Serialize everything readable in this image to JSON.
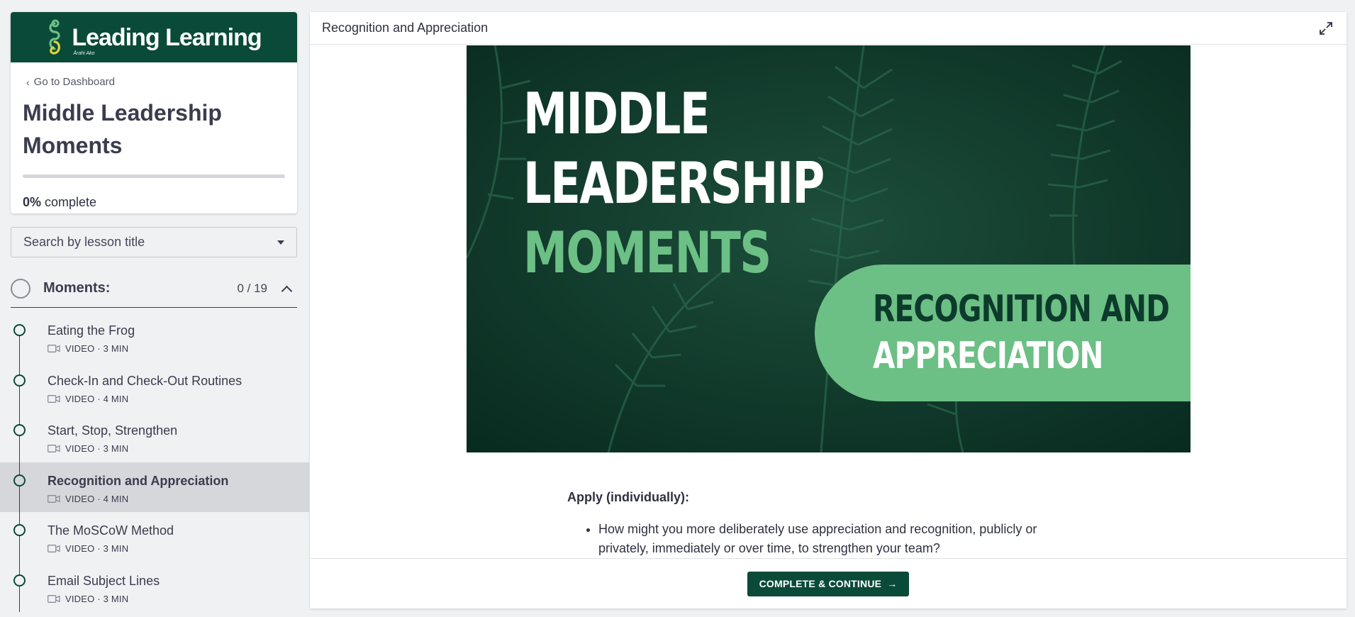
{
  "brand": {
    "name": "Leading Learning",
    "tagline": "Ārahi Ako",
    "color": "#0a4a38"
  },
  "sidebar": {
    "dashboard_link": "Go to Dashboard",
    "course_title": "Middle Leadership Moments",
    "progress": {
      "percent_label": "0%",
      "suffix": " complete",
      "value": 0
    },
    "search": {
      "placeholder": "Search by lesson title"
    },
    "chapter": {
      "title": "Moments:",
      "count": "0 / 19"
    },
    "lessons": [
      {
        "title": "Eating the Frog",
        "meta": "VIDEO · 3 MIN"
      },
      {
        "title": "Check-In and Check-Out Routines",
        "meta": "VIDEO · 4 MIN"
      },
      {
        "title": "Start, Stop, Strengthen",
        "meta": "VIDEO · 3 MIN"
      },
      {
        "title": "Recognition and Appreciation",
        "meta": "VIDEO · 4 MIN",
        "active": true
      },
      {
        "title": "The MoSCoW Method",
        "meta": "VIDEO · 3 MIN"
      },
      {
        "title": "Email Subject Lines",
        "meta": "VIDEO · 3 MIN"
      }
    ]
  },
  "main": {
    "header_title": "Recognition and Appreciation",
    "hero": {
      "line1": "MIDDLE",
      "line2": "LEADERSHIP",
      "line3": "MOMENTS",
      "pill_line1": "RECOGNITION AND",
      "pill_line2": "APPRECIATION"
    },
    "apply_heading": "Apply (individually):",
    "apply_items": [
      "How might you more deliberately use appreciation and recognition, publicly or privately, immediately or over time, to strengthen your team?"
    ],
    "complete_button": "COMPLETE & CONTINUE",
    "complete_arrow": "→"
  },
  "colors": {
    "accent": "#0a4a38",
    "hero_green": "#6cbf85",
    "active_row": "#d6d7db"
  }
}
